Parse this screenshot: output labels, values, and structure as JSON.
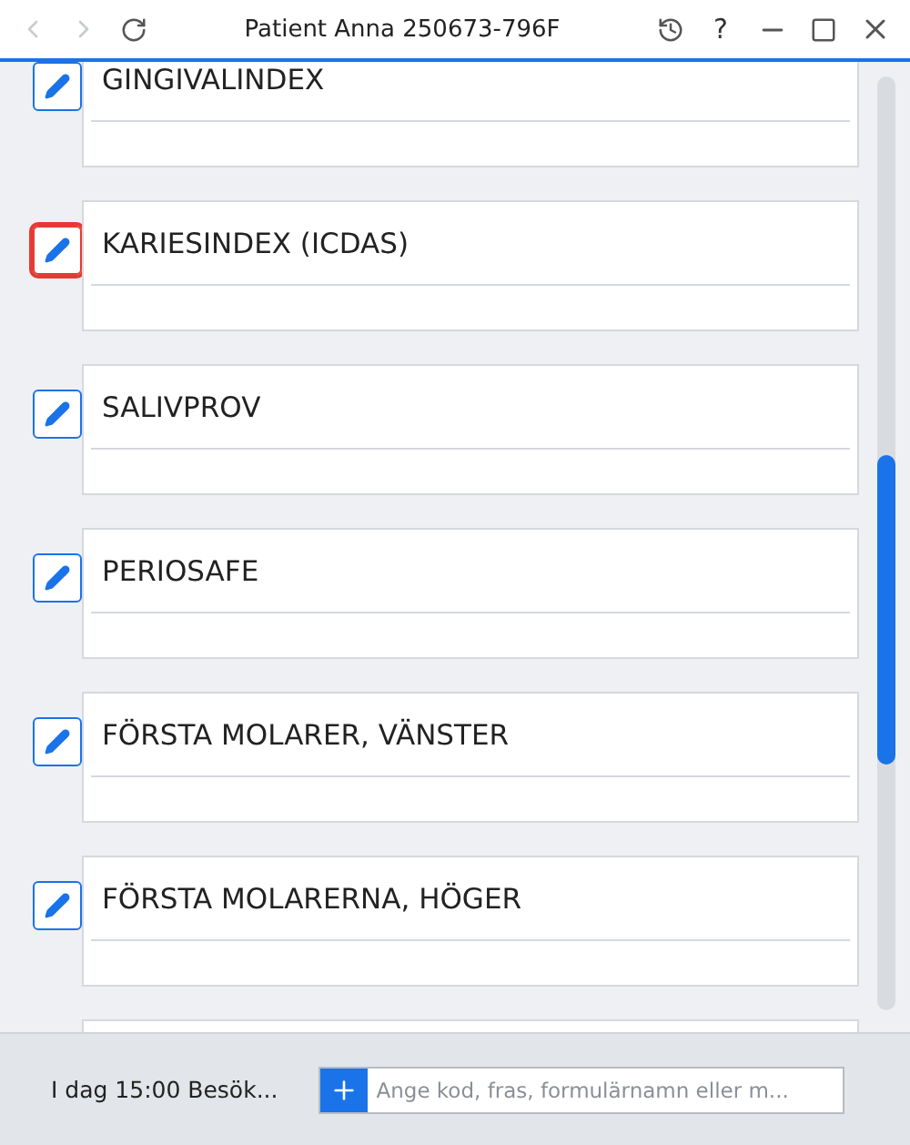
{
  "window": {
    "title": "Patient Anna 250673-796F",
    "back_disabled": true,
    "forward_disabled": true,
    "help": "?"
  },
  "forms": [
    {
      "title": "GINGIVALINDEX",
      "selected": false
    },
    {
      "title": "KARIESINDEX (ICDAS)",
      "selected": true
    },
    {
      "title": "SALIVPROV",
      "selected": false
    },
    {
      "title": "PERIOSAFE",
      "selected": false
    },
    {
      "title": "FÖRSTA MOLARER, VÄNSTER",
      "selected": false
    },
    {
      "title": "FÖRSTA MOLARERNA, HÖGER",
      "selected": false
    }
  ],
  "footer": {
    "visit": "I dag 15:00 Besök...",
    "search": {
      "placeholder": "Ange kod, fras, formulärnamn eller m..."
    }
  }
}
